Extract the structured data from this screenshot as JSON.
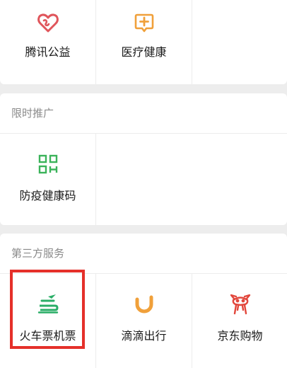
{
  "top_services": [
    {
      "label": "腾讯公益",
      "icon": "charity-heart-icon",
      "color": "#e0555b"
    },
    {
      "label": "医疗健康",
      "icon": "medical-plus-icon",
      "color": "#f0a03a"
    }
  ],
  "limited_promo": {
    "title": "限时推广",
    "items": [
      {
        "label": "防疫健康码",
        "icon": "qr-code-icon",
        "color": "#3bb35a"
      }
    ]
  },
  "third_party": {
    "title": "第三方服务",
    "items": [
      {
        "label": "火车票机票",
        "icon": "train-plane-icon",
        "color": "#2aae67",
        "highlighted": true
      },
      {
        "label": "滴滴出行",
        "icon": "didi-icon",
        "color": "#f0a03a"
      },
      {
        "label": "京东购物",
        "icon": "jd-dog-icon",
        "color": "#e2473c"
      }
    ]
  },
  "highlight_color": "#e5302a"
}
